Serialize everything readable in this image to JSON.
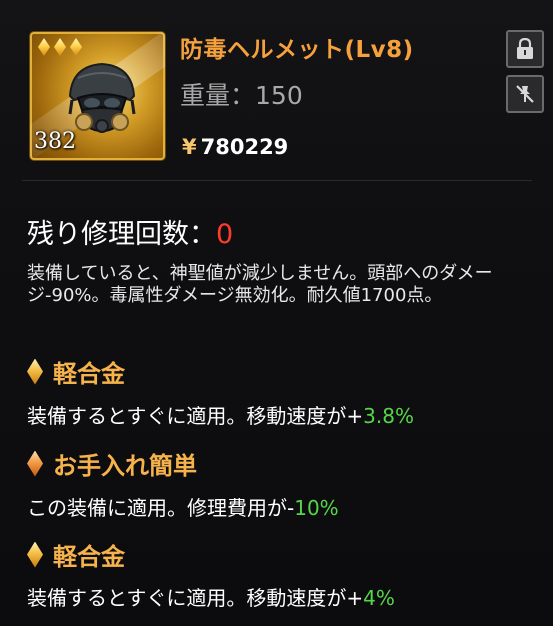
{
  "item": {
    "name": "防毒ヘルメット(Lv8)",
    "weight_label": "重量：",
    "weight_value": "150",
    "price_symbol": "¥",
    "price_value": "780229",
    "count": "382",
    "icon": "gas-mask-helmet-icon",
    "stars": 3
  },
  "buttons": {
    "lock_icon": "lock-icon",
    "unpin_icon": "no-pin-icon"
  },
  "repair": {
    "label": "残り修理回数：",
    "count": "0"
  },
  "description": "装備していると、神聖値が減少しません。頭部へのダメージ-90%。毒属性ダメージ無効化。耐久値1700点。",
  "effects": [
    {
      "title": "軽合金",
      "prefix": "装備するとすぐに適用。移動速度が+",
      "value": "3.8%",
      "suffix": ""
    },
    {
      "title": "お手入れ簡単",
      "prefix": "この装備に適用。修理費用が-",
      "value": "10%",
      "suffix": ""
    },
    {
      "title": "軽合金",
      "prefix": "装備するとすぐに適用。移動速度が+",
      "value": "4%",
      "suffix": ""
    }
  ],
  "colors": {
    "name": "#f6a13b",
    "section_title": "#f6b24b",
    "repair_count": "#ff3b2b",
    "positive_value": "#55d64a"
  }
}
